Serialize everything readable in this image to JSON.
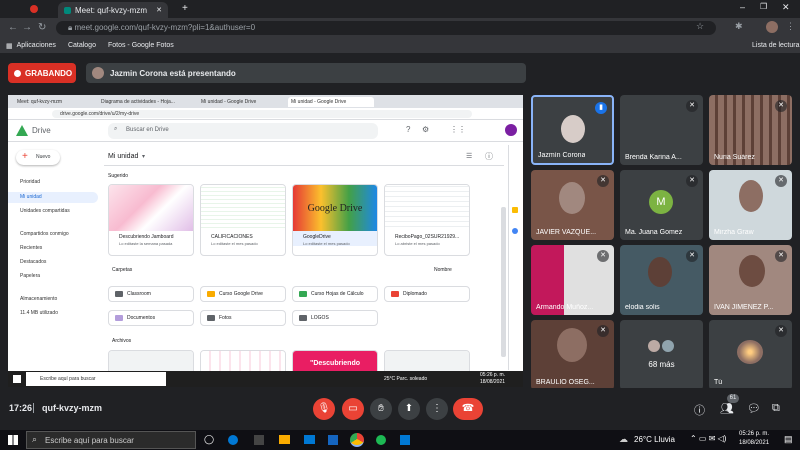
{
  "browser": {
    "tabs": [
      {
        "title": "Meet: quf-kvzy-mzm"
      }
    ],
    "url": "meet.google.com/quf-kvzy-mzm?pli=1&authuser=0",
    "bookmarks": [
      "Aplicaciones",
      "Catalogo",
      "Fotos - Google Fotos"
    ],
    "reading_list": "Lista de lectura"
  },
  "meet": {
    "recording_label": "GRABANDO",
    "presenting_text": "Jazmin Corona está presentando",
    "meeting_time": "17:26",
    "meeting_code": "quf-kvzy-mzm",
    "participants_badge": "61",
    "participants": [
      {
        "name": "Jazmín Corona",
        "speaking": true
      },
      {
        "name": "Brenda Karina A..."
      },
      {
        "name": "Nuria Suárez"
      },
      {
        "name": "JAVIER VAZQUE..."
      },
      {
        "name": "Ma. Juana Gomez",
        "initial": "M"
      },
      {
        "name": "Mirzha Graw"
      },
      {
        "name": "Armando Muñoz..."
      },
      {
        "name": "elodia solis"
      },
      {
        "name": "IVAN JIMENEZ P..."
      },
      {
        "name": "BRAULIO OSEG..."
      },
      {
        "name": "68 más"
      },
      {
        "name": "Tú"
      }
    ]
  },
  "drive": {
    "tabs": [
      "Meet: quf-kvzy-mzm",
      "Diagrama de actividades - Hoja...",
      "Mi unidad - Google Drive",
      "Mi unidad - Google Drive"
    ],
    "url": "drive.google.com/drive/u/2/my-drive",
    "app_name": "Drive",
    "search_placeholder": "Buscar en Drive",
    "new_button": "Nuevo",
    "sidebar": [
      "Prioridad",
      "Mi unidad",
      "Unidades compartidas",
      "Compartidos conmigo",
      "Recientes",
      "Destacados",
      "Papelera",
      "Almacenamiento",
      "11.4 MB utilizado"
    ],
    "title": "Mi unidad",
    "suggested_label": "Sugerido",
    "suggested": [
      {
        "name": "Descubriendo Jamboard",
        "sub": "Lo editaste la semana pasada"
      },
      {
        "name": "CALIFICACIONES",
        "sub": "Lo editaste el mes pasado"
      },
      {
        "name": "GoogleDrive",
        "sub": "Lo editaste el mes pasado",
        "thumb_text": "Google Drive"
      },
      {
        "name": "ReciboPago_02SUR21929...",
        "sub": "Lo abriste el mes pasado"
      }
    ],
    "folders_label": "Carpetas",
    "sort_label": "Nombre",
    "folders": [
      "Classroom",
      "Curso Google Drive",
      "Curso Hojas de Cálculo",
      "Diplomado",
      "Documentos",
      "Fotos",
      "LOGOS"
    ],
    "files_label": "Archivos",
    "file_thumb_text": "\"Descubriendo",
    "taskbar_search": "Escribe aquí para buscar",
    "weather": "25°C  Parc. soleado",
    "time": "05:26 p. m.",
    "date": "18/08/2021"
  },
  "taskbar": {
    "search_placeholder": "Escribe aquí para buscar",
    "weather": "26°C  Lluvia",
    "time": "05:26 p. m.",
    "date": "18/08/2021"
  },
  "colors": {
    "record": "#d93025",
    "hangup": "#ea4335",
    "speaking": "#8ab4f8",
    "drive_blue": "#1a73e8"
  }
}
